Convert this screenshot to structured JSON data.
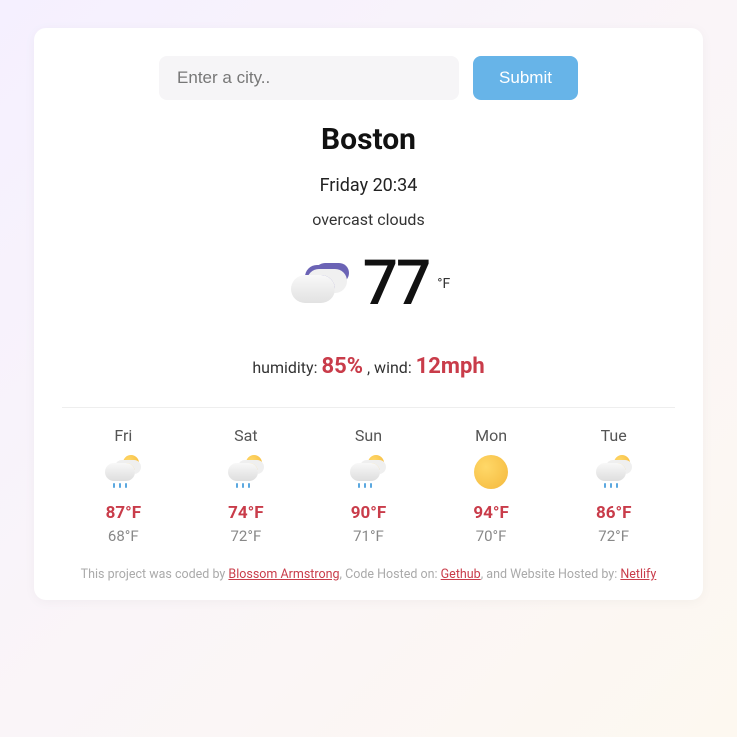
{
  "search": {
    "placeholder": "Enter a city..",
    "submit_label": "Submit"
  },
  "current": {
    "city": "Boston",
    "datetime": "Friday 20:34",
    "condition": "overcast clouds",
    "temp": "77",
    "unit": "°F",
    "humidity_label": "humidity:",
    "humidity": "85%",
    "wind_label": ", wind:",
    "wind": "12mph"
  },
  "forecast": [
    {
      "day": "Fri",
      "icon": "rain-sun",
      "high": "87°F",
      "low": "68°F"
    },
    {
      "day": "Sat",
      "icon": "rain-sun",
      "high": "74°F",
      "low": "72°F"
    },
    {
      "day": "Sun",
      "icon": "rain-sun",
      "high": "90°F",
      "low": "71°F"
    },
    {
      "day": "Mon",
      "icon": "sun",
      "high": "94°F",
      "low": "70°F"
    },
    {
      "day": "Tue",
      "icon": "rain-sun",
      "high": "86°F",
      "low": "72°F"
    }
  ],
  "footer": {
    "pre": "This project was coded by ",
    "link1": "Blossom Armstrong",
    "mid1": ", Code Hosted on: ",
    "link2": "Gethub",
    "mid2": ", and Website Hosted by: ",
    "link3": "Netlify"
  }
}
